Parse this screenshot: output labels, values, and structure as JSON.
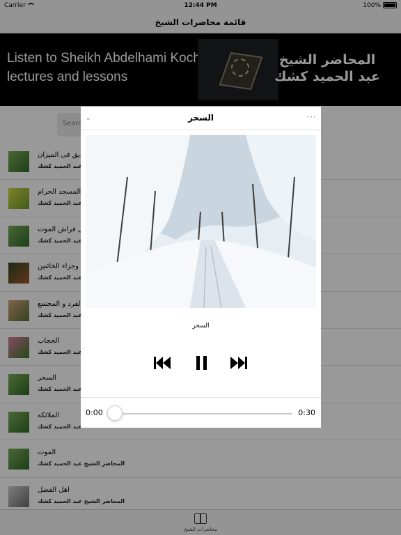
{
  "status_bar": {
    "carrier": "Carrier",
    "time": "12:44 PM",
    "battery": "100%"
  },
  "nav": {
    "title": "قائمة محاضرات الشيخ"
  },
  "banner": {
    "en_line1": "Listen to Sheikh Abdelhami Kochk",
    "en_line2": "lectures and lessons",
    "ar_line1": "المحاضر الشيخ",
    "ar_line2": "عبد الحميد كشك"
  },
  "search": {
    "placeholder": "Searc"
  },
  "lectures": [
    {
      "title": "ديق فى الميزان",
      "subtitle": "عبد الحميد كشك"
    },
    {
      "title": "المسجد الحرام",
      "subtitle": "عبد الحميد كشك"
    },
    {
      "title": "لى فراش الموت",
      "subtitle": "عبد الحميد كشك"
    },
    {
      "title": "وجزاء الخائنين",
      "subtitle": "عبد الحميد كشك"
    },
    {
      "title": "الفرد و المجتمع",
      "subtitle": "عبد الحميد كشك"
    },
    {
      "title": "الحجاب",
      "subtitle": "عبد الحميد كشك"
    },
    {
      "title": "السحر",
      "subtitle": "عبد الحميد كشك"
    },
    {
      "title": "الملائكه",
      "subtitle": "عبد الحميد كشك"
    },
    {
      "title": "الموت",
      "subtitle": "المحاضر الشيخ عبد الحميد كشك"
    },
    {
      "title": "اهل الفضل",
      "subtitle": "المحاضر الشيخ عبد الحميد كشك"
    }
  ],
  "tabbar": {
    "label": "محاضرات الشيخ"
  },
  "player": {
    "title": "السحر",
    "track_title": "السحر",
    "elapsed": "0:00",
    "duration": "0:30",
    "progress": 0,
    "icons": {
      "collapse": "chevron-down-icon",
      "more": "more-icon",
      "prev": "skip-back-icon",
      "pause": "pause-icon",
      "next": "skip-forward-icon"
    }
  }
}
